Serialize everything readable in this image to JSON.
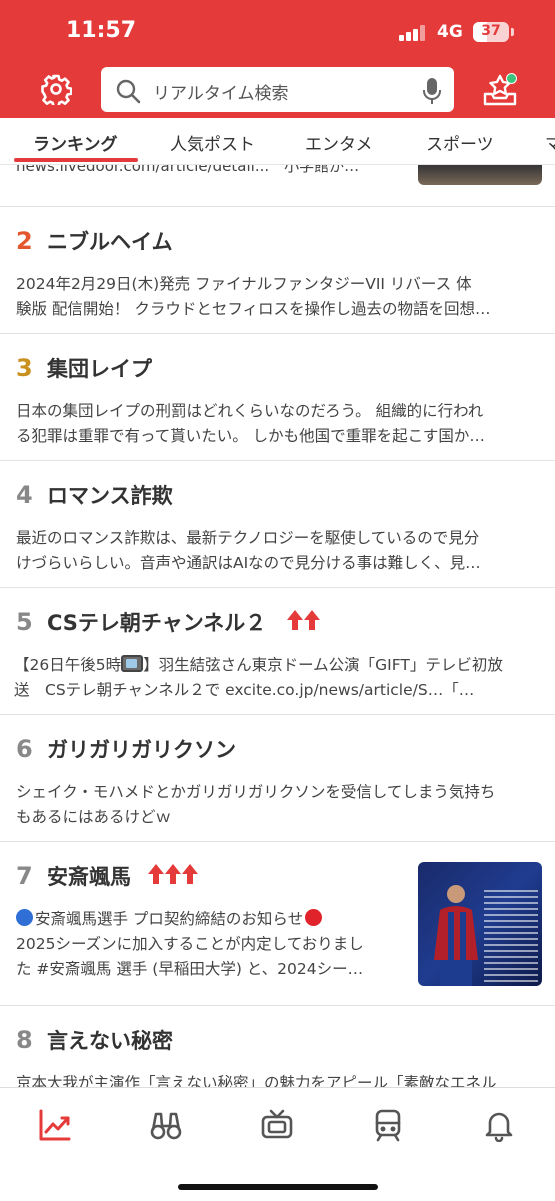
{
  "status_bar": {
    "time": "11:57",
    "network": "4G",
    "battery": "37"
  },
  "header": {
    "search": {
      "placeholder": "リアルタイム検索"
    },
    "icons": [
      "gear-icon",
      "search-icon",
      "microphone-icon",
      "inbox-icon"
    ],
    "accent_color": "#e53a3a"
  },
  "tabs": [
    {
      "label": "ランキング",
      "active": true
    },
    {
      "label": "人気ポスト"
    },
    {
      "label": "エンタメ"
    },
    {
      "label": "スポーツ"
    },
    {
      "label": "マ"
    }
  ],
  "feed": {
    "partial_item": {
      "text": "news.livedoor.com/article/detail...　小学館が…"
    },
    "items": [
      {
        "rank": "2",
        "title": "ニブルヘイム",
        "lines": [
          "2024年2月29日(木)発売 ファイナルファンタジーVII リバース 体",
          "験版 配信開始！ クラウドとセフィロスを操作し過去の物語を回想…"
        ]
      },
      {
        "rank": "3",
        "title": "集団レイプ",
        "lines": [
          "日本の集団レイプの刑罰はどれくらいなのだろう。 組織的に行われ",
          "る犯罪は重罪で有って貰いたい。 しかも他国で重罪を起こす国か…"
        ]
      },
      {
        "rank": "4",
        "title": "ロマンス詐欺",
        "lines": [
          "最近のロマンス詐欺は、最新テクノロジーを駆使しているので見分",
          "けづらいらしい。音声や通訳はAIなので見分ける事は難しく、見…"
        ]
      },
      {
        "rank": "5",
        "title": "CSテレ朝チャンネル２",
        "trend": 2,
        "line1_pre": "【26日午後5時",
        "line1_post": "】羽生結弦さん東京ドーム公演「GIFT」テレビ初放",
        "line2": "送　CSテレ朝チャンネル２で excite.co.jp/news/article/S…「…"
      },
      {
        "rank": "6",
        "title": "ガリガリガリクソン",
        "lines": [
          "シェイク・モハメドとかガリガリガリクソンを受信してしまう気持ち",
          "もあるにはあるけどｗ"
        ]
      },
      {
        "rank": "7",
        "title": "安斎颯馬",
        "trend": 3,
        "line1": "安斎颯馬選手 プロ契約締結のお知らせ",
        "line2": "2025シーズンに加入することが内定しておりまし",
        "line3": "た #安斎颯馬 選手 (早稲田大学) と、2024シー…"
      },
      {
        "rank": "8",
        "title": "言えない秘密",
        "lines": [
          "京本大我が主演作「言えない秘密」の魅力をアピール「素敵なエネル"
        ]
      }
    ],
    "rank_colors": {
      "2": "#e4572e",
      "3": "#c9901d",
      "default": "#888888"
    }
  },
  "bottom_nav": [
    "trending-icon",
    "binoculars-icon",
    "tv-icon",
    "train-icon",
    "bell-icon"
  ]
}
